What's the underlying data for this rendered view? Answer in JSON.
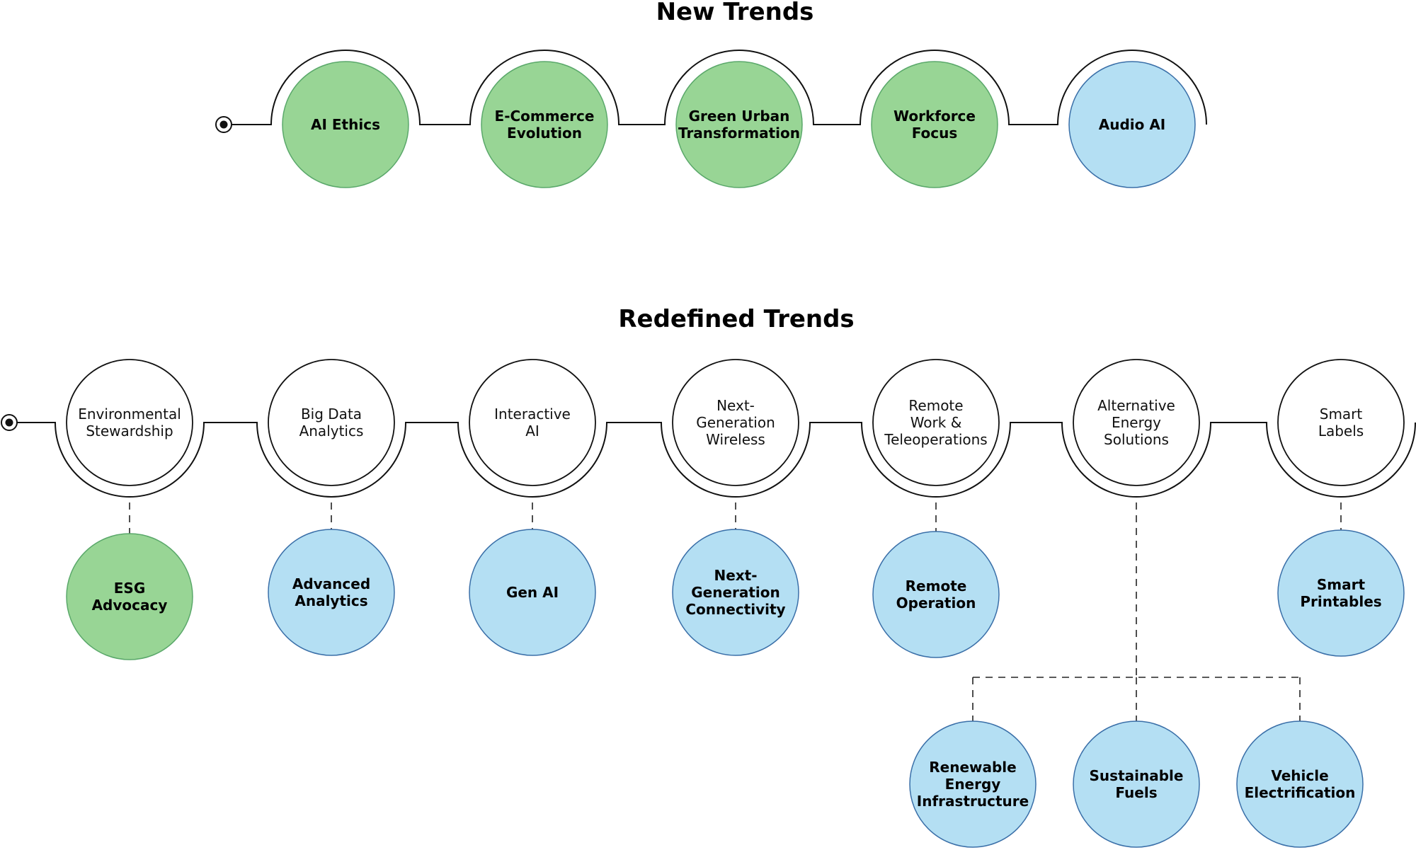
{
  "colors": {
    "green_fill": "#98d595",
    "blue_fill": "#b4dff3",
    "white_fill": "#ffffff",
    "line": "#111111"
  },
  "new_trends": {
    "title": "New Trends",
    "items": [
      {
        "label": [
          "AI Ethics"
        ],
        "color": "green"
      },
      {
        "label": [
          "E-Commerce",
          "Evolution"
        ],
        "color": "green"
      },
      {
        "label": [
          "Green Urban",
          "Transformation"
        ],
        "color": "green"
      },
      {
        "label": [
          "Workforce",
          "Focus"
        ],
        "color": "green"
      },
      {
        "label": [
          "Audio AI"
        ],
        "color": "blue"
      }
    ]
  },
  "redefined_trends": {
    "title": "Redefined Trends",
    "items": [
      {
        "label": [
          "Environmental",
          "Stewardship"
        ],
        "children": [
          {
            "label": [
              "ESG",
              "Advocacy"
            ],
            "color": "green"
          }
        ]
      },
      {
        "label": [
          "Big Data",
          "Analytics"
        ],
        "children": [
          {
            "label": [
              "Advanced",
              "Analytics"
            ],
            "color": "blue"
          }
        ]
      },
      {
        "label": [
          "Interactive",
          "AI"
        ],
        "children": [
          {
            "label": [
              "Gen AI"
            ],
            "color": "blue"
          }
        ]
      },
      {
        "label": [
          "Next-",
          "Generation",
          "Wireless"
        ],
        "children": [
          {
            "label": [
              "Next-",
              "Generation",
              "Connectivity"
            ],
            "color": "blue"
          }
        ]
      },
      {
        "label": [
          "Remote",
          "Work &",
          "Teleoperations"
        ],
        "children": [
          {
            "label": [
              "Remote",
              "Operation"
            ],
            "color": "blue"
          }
        ]
      },
      {
        "label": [
          "Alternative",
          "Energy",
          "Solutions"
        ],
        "children": [
          {
            "label": [
              "Renewable",
              "Energy",
              "Infrastructure"
            ],
            "color": "blue"
          },
          {
            "label": [
              "Sustainable",
              "Fuels"
            ],
            "color": "blue"
          },
          {
            "label": [
              "Vehicle",
              "Electrification"
            ],
            "color": "blue"
          }
        ]
      },
      {
        "label": [
          "Smart",
          "Labels"
        ],
        "children": [
          {
            "label": [
              "Smart",
              "Printables"
            ],
            "color": "blue"
          }
        ]
      }
    ]
  }
}
